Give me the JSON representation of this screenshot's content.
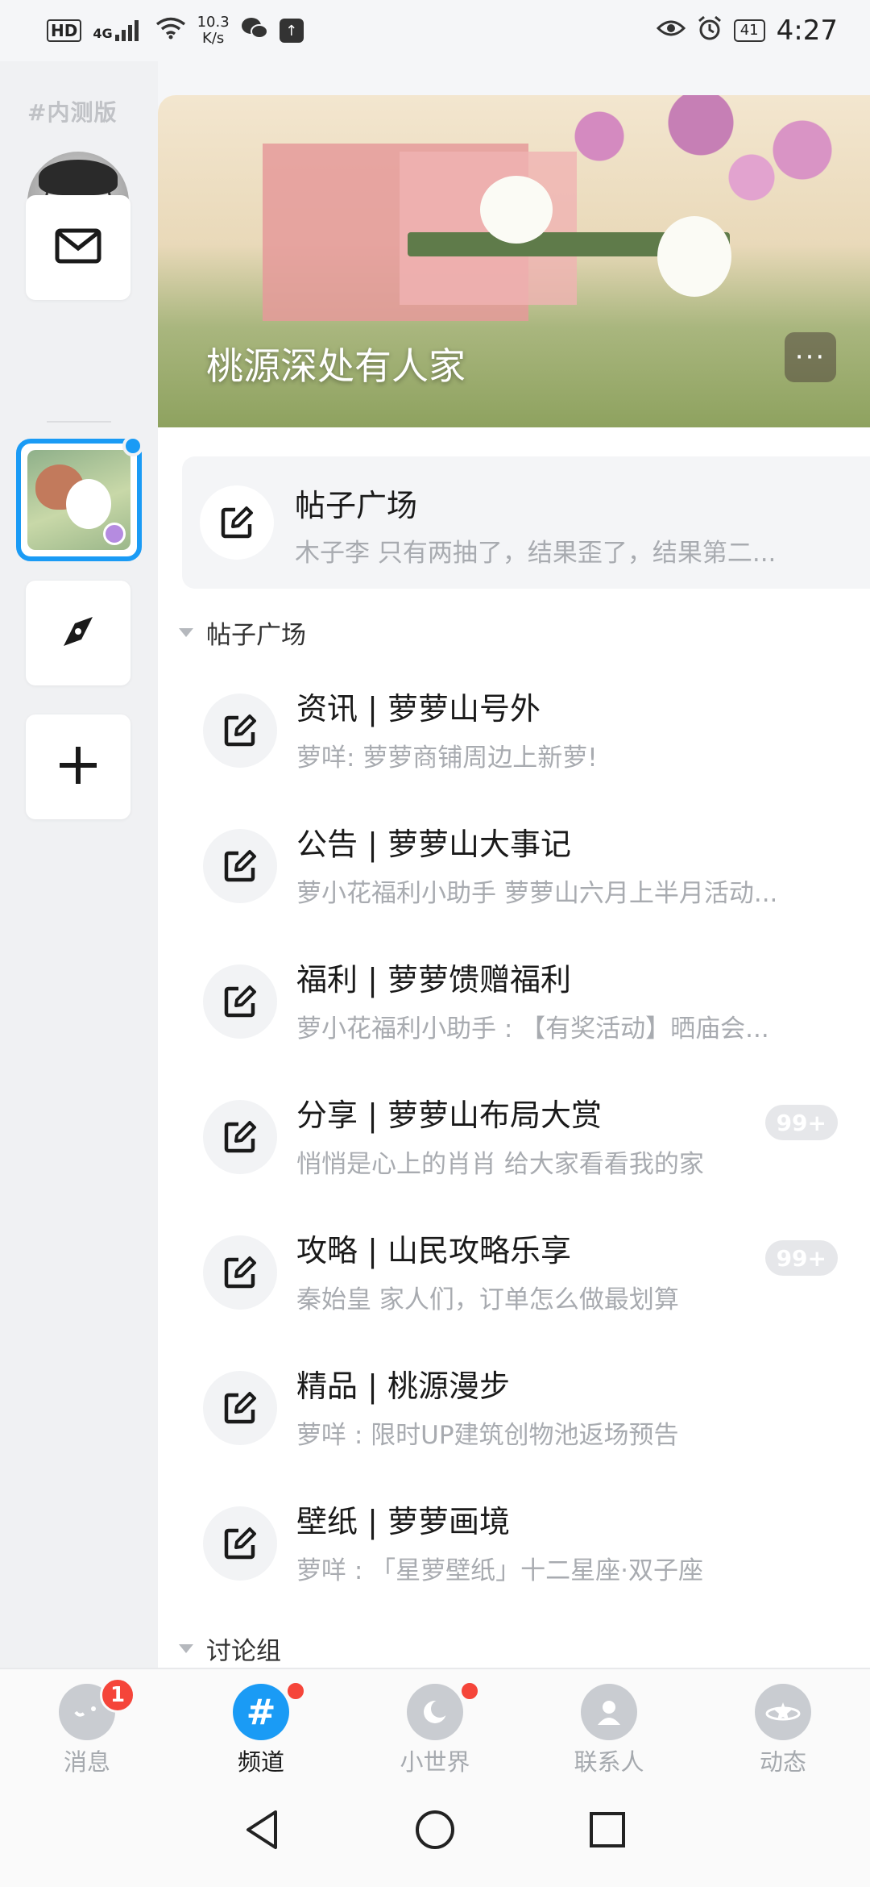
{
  "status_bar": {
    "network": "HD",
    "signal": "4G",
    "speed_value": "10.3",
    "speed_unit": "K/s",
    "battery": "41",
    "time": "4:27"
  },
  "sidebar": {
    "beta_label": "#内测版"
  },
  "banner": {
    "title": "桃源深处有人家",
    "more": "···"
  },
  "featured": {
    "title": "帖子广场",
    "subtitle": "木子李 只有两抽了，结果歪了，结果第二..."
  },
  "sections": [
    {
      "label": "帖子广场"
    },
    {
      "label": "讨论组"
    }
  ],
  "channels": [
    {
      "title": "资讯 | 萝萝山号外",
      "subtitle": "萝咩: 萝萝商铺周边上新萝!",
      "badge": ""
    },
    {
      "title": "公告 | 萝萝山大事记",
      "subtitle": "萝小花福利小助手 萝萝山六月上半月活动...",
      "badge": ""
    },
    {
      "title": "福利 | 萝萝馈赠福利",
      "subtitle": "萝小花福利小助手 : 【有奖活动】晒庙会...",
      "badge": ""
    },
    {
      "title": "分享 | 萝萝山布局大赏",
      "subtitle": "悄悄是心上的肖肖 给大家看看我的家",
      "badge": "99+"
    },
    {
      "title": "攻略 | 山民攻略乐享",
      "subtitle": "秦始皇 家人们，订单怎么做最划算",
      "badge": "99+"
    },
    {
      "title": "精品 | 桃源漫步",
      "subtitle": "萝咩 : 限时UP建筑创物池返场预告",
      "badge": ""
    },
    {
      "title": "壁纸 | 萝萝画境",
      "subtitle": "萝咩 : 「星萝壁纸」十二星座·双子座",
      "badge": ""
    }
  ],
  "bottom_nav": [
    {
      "label": "消息",
      "badge": "1"
    },
    {
      "label": "频道",
      "icon_glyph": "#"
    },
    {
      "label": "小世界"
    },
    {
      "label": "联系人"
    },
    {
      "label": "动态"
    }
  ],
  "colors": {
    "accent": "#1a9bf5",
    "badge_red": "#f5453a",
    "muted_text": "#a8abb0"
  }
}
